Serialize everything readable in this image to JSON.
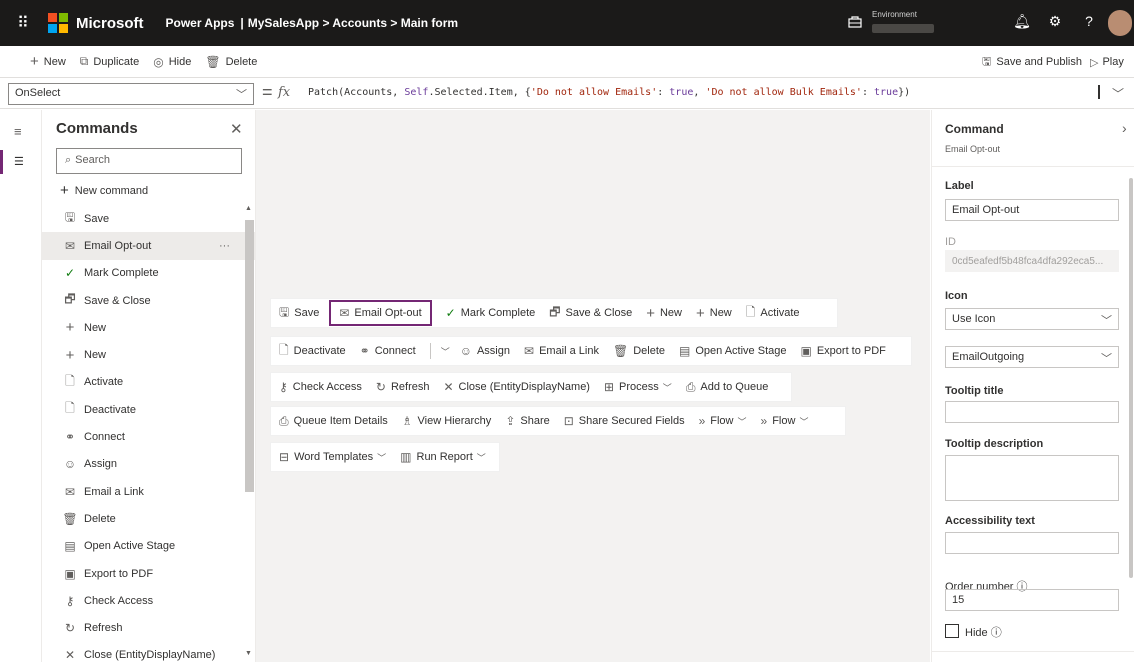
{
  "topbar": {
    "brand": "Microsoft",
    "app_title": "Power Apps",
    "separator": "|",
    "breadcrumb": "MySalesApp > Accounts > Main form",
    "environment_label": "Environment",
    "logo_colors": [
      "#f25022",
      "#7fba00",
      "#00a4ef",
      "#ffb900"
    ]
  },
  "cmdbar": {
    "new": "New",
    "duplicate": "Duplicate",
    "hide": "Hide",
    "delete": "Delete",
    "save_publish": "Save and Publish",
    "play": "Play"
  },
  "formula": {
    "property": "OnSelect",
    "fx": "fx",
    "fn": "Patch",
    "args_a": "(Accounts, ",
    "self": "Self",
    "args_b": ".Selected.Item, {",
    "str1": "'Do not allow Emails'",
    "mid": ": ",
    "true1": "true",
    "comma": ", ",
    "str2": "'Do not allow Bulk Emails'",
    "mid2": ": ",
    "true2": "true",
    "close": "})"
  },
  "commands_panel": {
    "title": "Commands",
    "search_placeholder": "Search",
    "new_command": "New command",
    "items": [
      {
        "label": "Save",
        "icon": "save-icon"
      },
      {
        "label": "Email Opt-out",
        "icon": "email-optout-icon",
        "selected": true
      },
      {
        "label": "Mark Complete",
        "icon": "checkmark-icon"
      },
      {
        "label": "Save & Close",
        "icon": "save-close-icon"
      },
      {
        "label": "New",
        "icon": "plus-icon"
      },
      {
        "label": "New",
        "icon": "plus-icon"
      },
      {
        "label": "Activate",
        "icon": "activate-icon"
      },
      {
        "label": "Deactivate",
        "icon": "deactivate-icon"
      },
      {
        "label": "Connect",
        "icon": "connect-icon"
      },
      {
        "label": "Assign",
        "icon": "assign-icon"
      },
      {
        "label": "Email a Link",
        "icon": "email-link-icon"
      },
      {
        "label": "Delete",
        "icon": "delete-icon"
      },
      {
        "label": "Open Active Stage",
        "icon": "stage-icon"
      },
      {
        "label": "Export to PDF",
        "icon": "pdf-icon"
      },
      {
        "label": "Check Access",
        "icon": "check-access-icon"
      },
      {
        "label": "Refresh",
        "icon": "refresh-icon"
      },
      {
        "label": "Close (EntityDisplayName)",
        "icon": "close-icon"
      }
    ]
  },
  "ribbon": {
    "row1": [
      "Save",
      "Email Opt-out",
      "Mark Complete",
      "Save & Close",
      "New",
      "New",
      "Activate"
    ],
    "row2": [
      "Deactivate",
      "Connect",
      "Assign",
      "Email a Link",
      "Delete",
      "Open Active Stage",
      "Export to PDF"
    ],
    "row3": [
      "Check Access",
      "Refresh",
      "Close (EntityDisplayName)",
      "Process",
      "Add to Queue"
    ],
    "row4": [
      "Queue Item Details",
      "View Hierarchy",
      "Share",
      "Share Secured Fields",
      "Flow",
      "Flow"
    ],
    "row5": [
      "Word Templates",
      "Run Report"
    ]
  },
  "properties": {
    "title": "Command",
    "subtitle": "Email Opt-out",
    "label_label": "Label",
    "label_value": "Email Opt-out",
    "id_label": "ID",
    "id_value": "0cd5eafedf5b48fca4dfa292eca5...",
    "icon_label": "Icon",
    "icon_mode": "Use Icon",
    "icon_value": "EmailOutgoing",
    "tooltip_title_label": "Tooltip title",
    "tooltip_desc_label": "Tooltip description",
    "accessibility_label": "Accessibility text",
    "order_label": "Order number",
    "order_value": "15",
    "hide_label": "Hide"
  },
  "colors": {
    "accent": "#742774",
    "topbar": "#1b1a19"
  }
}
